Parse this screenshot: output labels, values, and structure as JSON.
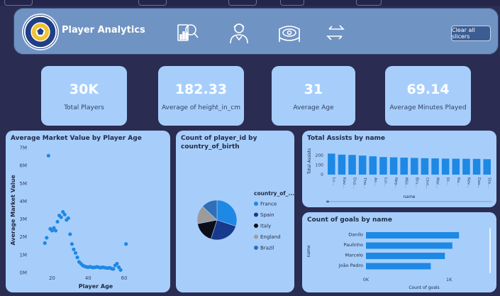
{
  "app": {
    "title": "Player Analytics",
    "clear_slicers_label": "Clear all slicers",
    "nav_icons": [
      "report-search-icon",
      "player-profile-icon",
      "stadium-icon",
      "swap-arrows-icon"
    ]
  },
  "kpis": [
    {
      "value": "30K",
      "label": "Total Players"
    },
    {
      "value": "182.33",
      "label": "Average of height_in_cm"
    },
    {
      "value": "31",
      "label": "Average Age"
    },
    {
      "value": "69.14",
      "label": "Average Minutes Played"
    }
  ],
  "colors": {
    "background": "#2a2c52",
    "header": "#6f93c3",
    "card": "#a7cefb",
    "accent": "#1e88e5"
  },
  "chart_data": [
    {
      "type": "scatter",
      "title": "Average Market Value by Player Age",
      "xlabel": "Player Age",
      "ylabel": "Average Market Value",
      "xlim": [
        10,
        80
      ],
      "ylim": [
        0,
        7000000
      ],
      "x_ticks": [
        20,
        40,
        60
      ],
      "y_ticks": [
        "0M",
        "1M",
        "2M",
        "3M",
        "4M",
        "5M",
        "6M",
        "7M"
      ],
      "points": [
        [
          16,
          1650000
        ],
        [
          17,
          1950000
        ],
        [
          18,
          6550000
        ],
        [
          19,
          2450000
        ],
        [
          20,
          2350000
        ],
        [
          21,
          2500000
        ],
        [
          22,
          2350000
        ],
        [
          23,
          2850000
        ],
        [
          24,
          3200000
        ],
        [
          25,
          3100000
        ],
        [
          26,
          3400000
        ],
        [
          27,
          3250000
        ],
        [
          28,
          2950000
        ],
        [
          29,
          3050000
        ],
        [
          30,
          2150000
        ],
        [
          31,
          1600000
        ],
        [
          32,
          1300000
        ],
        [
          33,
          1100000
        ],
        [
          34,
          850000
        ],
        [
          35,
          600000
        ],
        [
          36,
          500000
        ],
        [
          37,
          400000
        ],
        [
          38,
          350000
        ],
        [
          39,
          320000
        ],
        [
          40,
          300000
        ],
        [
          41,
          330000
        ],
        [
          42,
          300000
        ],
        [
          43,
          280000
        ],
        [
          44,
          300000
        ],
        [
          45,
          320000
        ],
        [
          46,
          290000
        ],
        [
          47,
          270000
        ],
        [
          48,
          300000
        ],
        [
          49,
          280000
        ],
        [
          50,
          260000
        ],
        [
          51,
          250000
        ],
        [
          52,
          270000
        ],
        [
          53,
          220000
        ],
        [
          54,
          200000
        ],
        [
          55,
          400000
        ],
        [
          56,
          500000
        ],
        [
          57,
          300000
        ],
        [
          58,
          150000
        ],
        [
          61,
          1600000
        ]
      ]
    },
    {
      "type": "pie",
      "title": "Count of player_id by country_of_birth",
      "legend_title": "country_of_...",
      "legend_position": "right",
      "slices": [
        {
          "label": "France",
          "value": 30,
          "color": "#1e88e5"
        },
        {
          "label": "Spain",
          "value": 25,
          "color": "#173a8c"
        },
        {
          "label": "Italy",
          "value": 17,
          "color": "#0d0d1a"
        },
        {
          "label": "England",
          "value": 15,
          "color": "#9b9b9b"
        },
        {
          "label": "Brazil",
          "value": 13,
          "color": "#2f6fb8"
        }
      ]
    },
    {
      "type": "bar",
      "title": "Total Assists by name",
      "xlabel": "name",
      "ylabel": "Total Assists",
      "ylim": [
        0,
        250
      ],
      "y_ticks": [
        0,
        100,
        200
      ],
      "categories": [
        "Lu...",
        "Kav...",
        "Dus...",
        "Tho...",
        "An...",
        "Lui...",
        "Ney...",
        "Mül...",
        "Bru...",
        "Chri...",
        "Mar...",
        "Di...",
        "Ra...",
        "Kev...",
        "Dav...",
        "Sta..."
      ],
      "values": [
        218,
        207,
        204,
        197,
        190,
        182,
        179,
        176,
        173,
        170,
        168,
        166,
        165,
        164,
        163,
        160
      ]
    },
    {
      "type": "bar",
      "orientation": "horizontal",
      "title": "Count of goals by name",
      "xlabel": "Count of goals",
      "ylabel": "name",
      "x_ticks": [
        "0K",
        "1K"
      ],
      "xlim": [
        0,
        1400
      ],
      "categories": [
        "Danilo",
        "Paulinho",
        "Marcelo",
        "João Pedro"
      ],
      "values": [
        1120,
        1040,
        950,
        780
      ]
    }
  ]
}
